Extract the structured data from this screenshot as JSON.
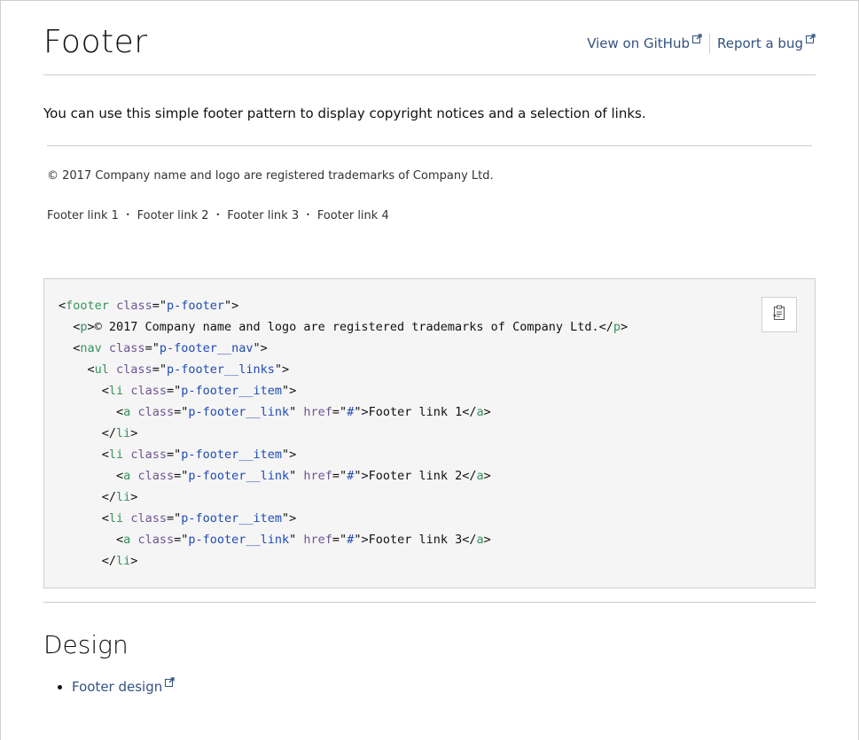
{
  "header": {
    "title": "Footer",
    "github_link": "View on GitHub",
    "bug_link": "Report a bug"
  },
  "intro": "You can use this simple footer pattern to display copyright notices and a selection of links.",
  "example": {
    "copyright": "© 2017 Company name and logo are registered trademarks of Company Ltd.",
    "links": [
      "Footer link 1",
      "Footer link 2",
      "Footer link 3",
      "Footer link 4"
    ]
  },
  "code": {
    "lines": [
      "<footer class=\"p-footer\">",
      "  <p>© 2017 Company name and logo are registered trademarks of Company Ltd.</p>",
      "  <nav class=\"p-footer__nav\">",
      "    <ul class=\"p-footer__links\">",
      "      <li class=\"p-footer__item\">",
      "        <a class=\"p-footer__link\" href=\"#\">Footer link 1</a>",
      "      </li>",
      "      <li class=\"p-footer__item\">",
      "        <a class=\"p-footer__link\" href=\"#\">Footer link 2</a>",
      "      </li>",
      "      <li class=\"p-footer__item\">",
      "        <a class=\"p-footer__link\" href=\"#\">Footer link 3</a>",
      "      </li>"
    ],
    "copy_icon": "clipboard-icon"
  },
  "design": {
    "heading": "Design",
    "link": "Footer design"
  },
  "colors": {
    "link": "#335280",
    "tag": "#37915f",
    "attribute": "#6e5494",
    "value": "#1f4bb3",
    "code_bg": "#f5f5f5"
  }
}
